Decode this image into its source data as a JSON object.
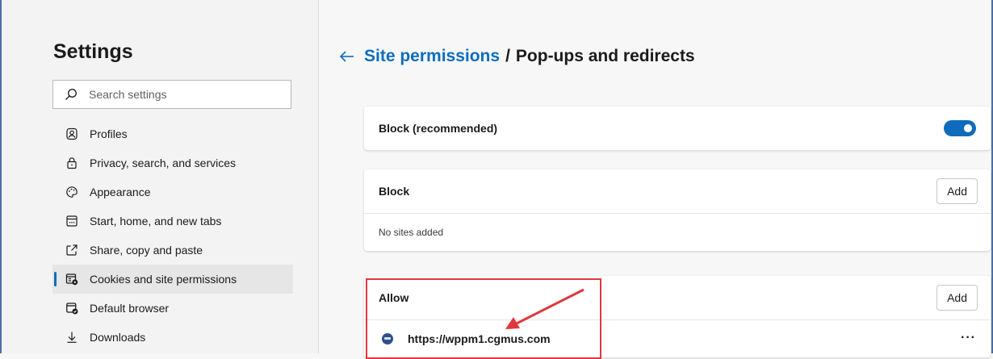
{
  "sidebar": {
    "title": "Settings",
    "search": {
      "placeholder": "Search settings",
      "icon": "search-icon"
    },
    "items": [
      {
        "label": "Profiles",
        "icon": "profile-icon"
      },
      {
        "label": "Privacy, search, and services",
        "icon": "lock-icon"
      },
      {
        "label": "Appearance",
        "icon": "palette-icon"
      },
      {
        "label": "Start, home, and new tabs",
        "icon": "home-tabs-icon"
      },
      {
        "label": "Share, copy and paste",
        "icon": "share-icon"
      },
      {
        "label": "Cookies and site permissions",
        "icon": "cookies-permissions-icon",
        "active": true
      },
      {
        "label": "Default browser",
        "icon": "default-browser-icon"
      },
      {
        "label": "Downloads",
        "icon": "download-icon"
      }
    ]
  },
  "header": {
    "breadcrumb_link": "Site permissions",
    "separator": "/",
    "current": "Pop-ups and redirects"
  },
  "block_recommended": {
    "label": "Block (recommended)",
    "enabled": true
  },
  "block": {
    "title": "Block",
    "add_label": "Add",
    "empty_text": "No sites added"
  },
  "allow": {
    "title": "Allow",
    "add_label": "Add",
    "sites": [
      {
        "url": "https://wppm1.cgmus.com"
      }
    ]
  },
  "colors": {
    "accent": "#0f6cbd",
    "annotation": "#e0383e"
  }
}
